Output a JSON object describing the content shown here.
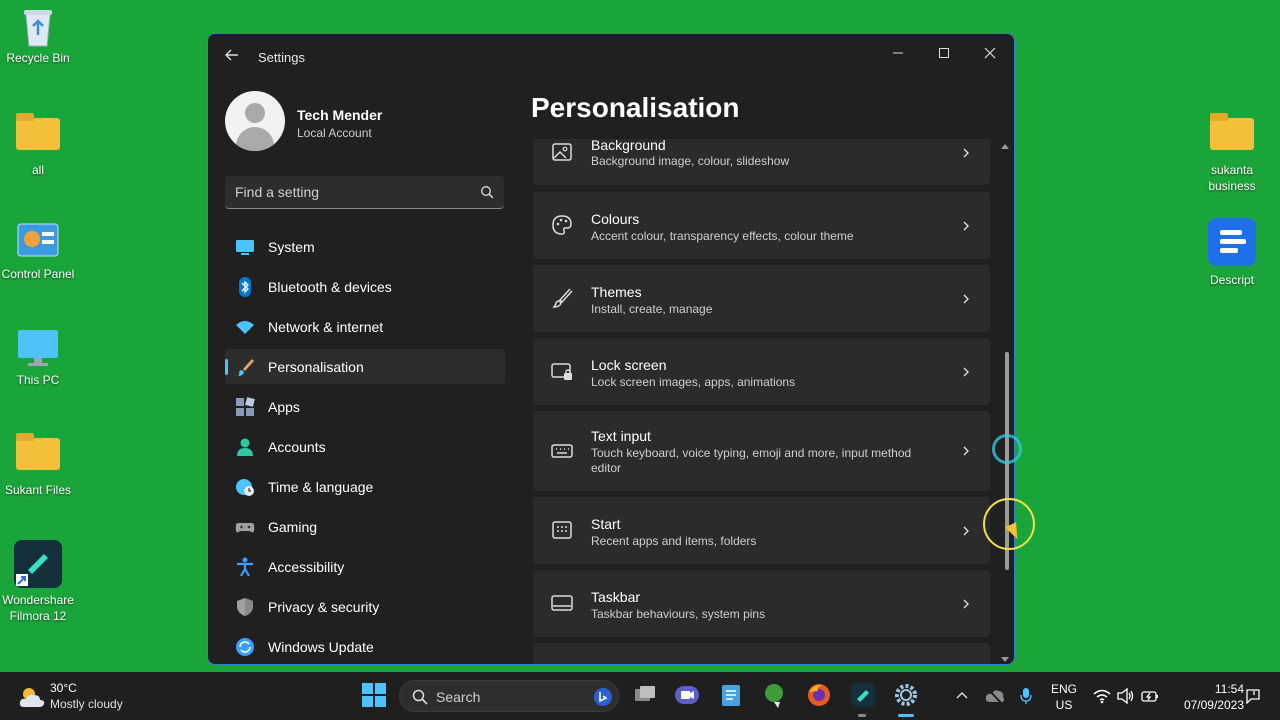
{
  "desktop": {
    "left_icons": [
      {
        "label": "Recycle Bin",
        "icon": "recycle-bin-icon"
      },
      {
        "label": "all",
        "icon": "folder-icon"
      },
      {
        "label": "Control Panel",
        "icon": "control-panel-icon"
      },
      {
        "label": "This PC",
        "icon": "monitor-icon"
      },
      {
        "label": "Sukant Files",
        "icon": "folder-icon"
      },
      {
        "label": "Wondershare Filmora 12",
        "icon": "filmora-icon"
      }
    ],
    "right_icons": [
      {
        "label": "sukanta business",
        "icon": "folder-icon"
      },
      {
        "label": "Descript",
        "icon": "descript-icon"
      }
    ]
  },
  "window": {
    "title": "Settings",
    "profile": {
      "name": "Tech Mender",
      "account_type": "Local Account"
    },
    "search": {
      "placeholder": "Find a setting"
    },
    "nav": [
      {
        "label": "System",
        "icon": "display-icon",
        "color": "#4cc2ff"
      },
      {
        "label": "Bluetooth & devices",
        "icon": "bluetooth-icon",
        "color": "#0078d4"
      },
      {
        "label": "Network & internet",
        "icon": "wifi-icon",
        "color": "#4cc2ff"
      },
      {
        "label": "Personalisation",
        "icon": "brush-icon",
        "color": "#e8a46a",
        "active": true
      },
      {
        "label": "Apps",
        "icon": "apps-icon",
        "color": "#8a9bb8"
      },
      {
        "label": "Accounts",
        "icon": "accounts-icon",
        "color": "#2fc7a4"
      },
      {
        "label": "Time & language",
        "icon": "globe-clock-icon",
        "color": "#4cc2ff"
      },
      {
        "label": "Gaming",
        "icon": "gamepad-icon",
        "color": "#a0a0a0"
      },
      {
        "label": "Accessibility",
        "icon": "accessibility-icon",
        "color": "#3aa0ff"
      },
      {
        "label": "Privacy & security",
        "icon": "shield-icon",
        "color": "#a0a0a0"
      },
      {
        "label": "Windows Update",
        "icon": "update-icon",
        "color": "#3aa0ff"
      }
    ],
    "page_title": "Personalisation",
    "cards": [
      {
        "title": "Background",
        "subtitle": "Background image, colour, slideshow",
        "icon": "image-icon"
      },
      {
        "title": "Colours",
        "subtitle": "Accent colour, transparency effects, colour theme",
        "icon": "palette-icon"
      },
      {
        "title": "Themes",
        "subtitle": "Install, create, manage",
        "icon": "brush-icon"
      },
      {
        "title": "Lock screen",
        "subtitle": "Lock screen images, apps, animations",
        "icon": "lock-screen-icon"
      },
      {
        "title": "Text input",
        "subtitle": "Touch keyboard, voice typing, emoji and more, input method editor",
        "icon": "keyboard-icon"
      },
      {
        "title": "Start",
        "subtitle": "Recent apps and items, folders",
        "icon": "start-icon"
      },
      {
        "title": "Taskbar",
        "subtitle": "Taskbar behaviours, system pins",
        "icon": "taskbar-icon"
      }
    ]
  },
  "taskbar": {
    "weather": {
      "temp": "30°C",
      "desc": "Mostly cloudy"
    },
    "search_label": "Search",
    "language": {
      "line1": "ENG",
      "line2": "US"
    },
    "clock": {
      "time": "11:54",
      "date": "07/09/2023"
    }
  },
  "colors": {
    "accent": "#4cc2ff",
    "window_bg": "#202020",
    "card_bg": "#2b2b2b",
    "desktop_bg": "#1aa53a"
  }
}
